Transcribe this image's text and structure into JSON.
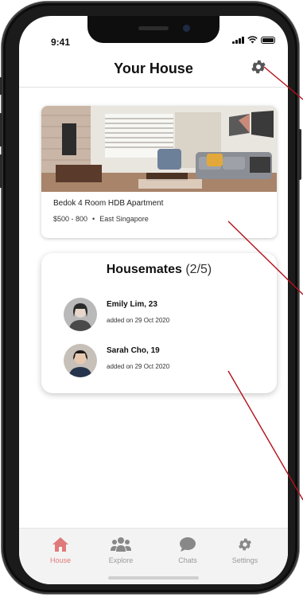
{
  "status_bar": {
    "time": "9:41"
  },
  "header": {
    "title": "Your House"
  },
  "house": {
    "name": "Bedok 4 Room HDB Apartment",
    "price": "$500 - 800",
    "separator": "•",
    "location": "East Singapore"
  },
  "housemates": {
    "title": "Housemates",
    "count": "(2/5)",
    "items": [
      {
        "name": "Emily Lim, 23",
        "added": "added on 29 Oct 2020"
      },
      {
        "name": "Sarah Cho, 19",
        "added": "added on 29 Oct 2020"
      }
    ]
  },
  "tabs": [
    {
      "label": "House",
      "icon": "home-icon",
      "active": true
    },
    {
      "label": "Explore",
      "icon": "people-icon",
      "active": false
    },
    {
      "label": "Chats",
      "icon": "chat-bubble-icon",
      "active": false
    },
    {
      "label": "Settings",
      "icon": "gear-icon",
      "active": false
    }
  ],
  "colors": {
    "accent": "#e07a7a",
    "inactive_tab": "#9a9a9a",
    "annotation_line": "#b3101a"
  }
}
